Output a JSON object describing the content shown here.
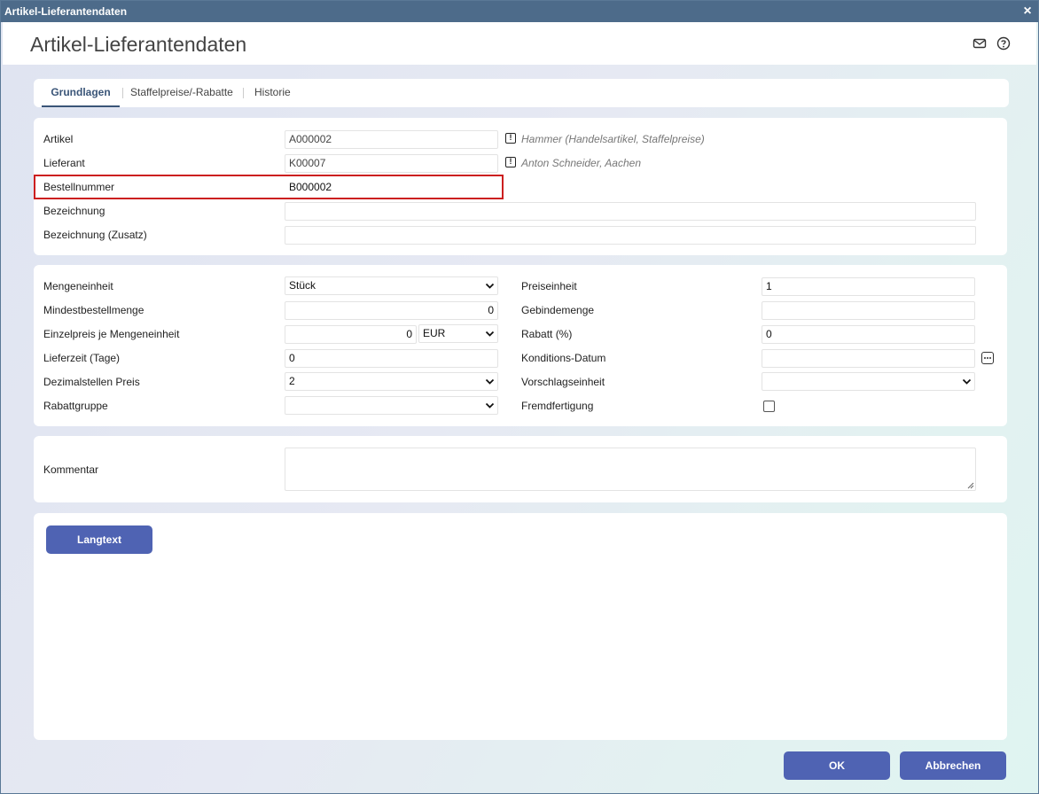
{
  "window": {
    "title": "Artikel-Lieferantendaten",
    "close_glyph": "×"
  },
  "header": {
    "title": "Artikel-Lieferantendaten",
    "icons": [
      "mail-icon",
      "help-icon"
    ]
  },
  "tabs": [
    {
      "label": "Grundlagen",
      "active": true
    },
    {
      "label": "Staffelpreise/-Rabatte",
      "active": false
    },
    {
      "label": "Historie",
      "active": false
    }
  ],
  "general": {
    "artikel": {
      "label": "Artikel",
      "value": "A000002",
      "hint": "Hammer (Handelsartikel, Staffelpreise)"
    },
    "lieferant": {
      "label": "Lieferant",
      "value": "K00007",
      "hint": "Anton Schneider, Aachen"
    },
    "bestellnummer": {
      "label": "Bestellnummer",
      "value": "B000002"
    },
    "bezeichnung": {
      "label": "Bezeichnung",
      "value": ""
    },
    "bezeichnung_zusatz": {
      "label": "Bezeichnung (Zusatz)",
      "value": ""
    },
    "warn_glyph": "!"
  },
  "details": {
    "mengeneinheit": {
      "label": "Mengeneinheit",
      "value": "Stück"
    },
    "mindestbestellmenge": {
      "label": "Mindestbestellmenge",
      "value": "0"
    },
    "einzelpreis": {
      "label": "Einzelpreis je Mengeneinheit",
      "value": "0",
      "currency": "EUR"
    },
    "lieferzeit": {
      "label": "Lieferzeit (Tage)",
      "value": "0"
    },
    "dezimalstellen": {
      "label": "Dezimalstellen Preis",
      "value": "2"
    },
    "rabattgruppe": {
      "label": "Rabattgruppe",
      "value": ""
    },
    "preiseinheit": {
      "label": "Preiseinheit",
      "value": "1"
    },
    "gebindemenge": {
      "label": "Gebindemenge",
      "value": ""
    },
    "rabatt": {
      "label": "Rabatt (%)",
      "value": "0"
    },
    "konditions_datum": {
      "label": "Konditions-Datum",
      "value": ""
    },
    "vorschlagseinheit": {
      "label": "Vorschlagseinheit",
      "value": ""
    },
    "fremdfertigung": {
      "label": "Fremdfertigung",
      "checked": false
    }
  },
  "comment": {
    "label": "Kommentar",
    "value": ""
  },
  "langtext": {
    "button_label": "Langtext"
  },
  "footer": {
    "ok_label": "OK",
    "cancel_label": "Abbrechen"
  },
  "colors": {
    "titlebar": "#4d6b8a",
    "button": "#4f63b3",
    "highlight": "#cc1f1f",
    "active_tab": "#3a5578"
  }
}
